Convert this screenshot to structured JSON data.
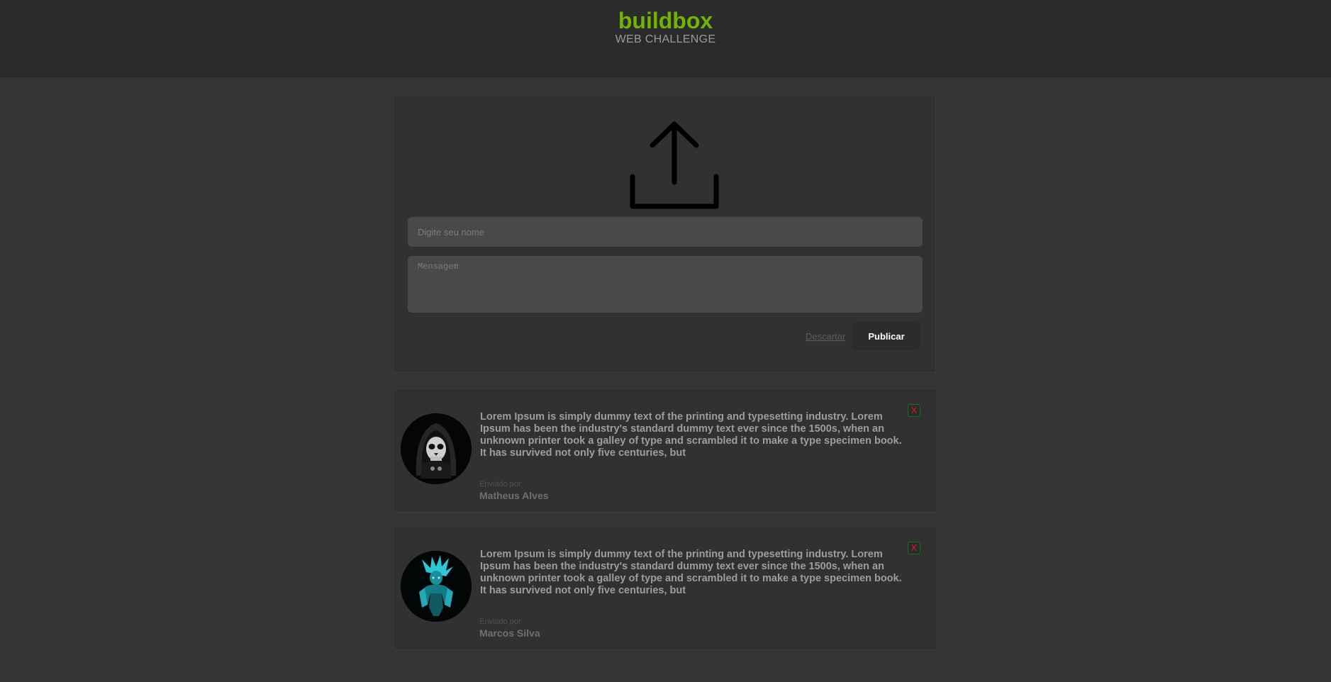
{
  "header": {
    "title": "buildbox",
    "subtitle": "WEB CHALLENGE"
  },
  "composer": {
    "upload_icon": "upload-arrow-icon",
    "name_placeholder": "Digite seu nome",
    "message_placeholder": "Mensagem",
    "discard_label": "Descartar",
    "publish_label": "Publicar"
  },
  "posts": [
    {
      "avatar": "hooded-skull-avatar",
      "text": "Lorem Ipsum is simply dummy text of the printing and typesetting industry. Lorem Ipsum has been the industry's standard dummy text ever since the 1500s, when an unknown printer took a galley of type and scrambled it to make a type specimen book. It has survived not only five centuries, but",
      "sent_by_label": "Enviado por",
      "author": "Matheus Alves",
      "delete_label": "X"
    },
    {
      "avatar": "cyan-warrior-avatar",
      "text": "Lorem Ipsum is simply dummy text of the printing and typesetting industry. Lorem Ipsum has been the industry's standard dummy text ever since the 1500s, when an unknown printer took a galley of type and scrambled it to make a type specimen book. It has survived not only five centuries, but",
      "sent_by_label": "Enviado por",
      "author": "Marcos Silva",
      "delete_label": "X"
    }
  ],
  "colors": {
    "brand": "#71b307",
    "background": "#343434",
    "header": "#2b2b2b",
    "delete": "#e01b1b"
  }
}
